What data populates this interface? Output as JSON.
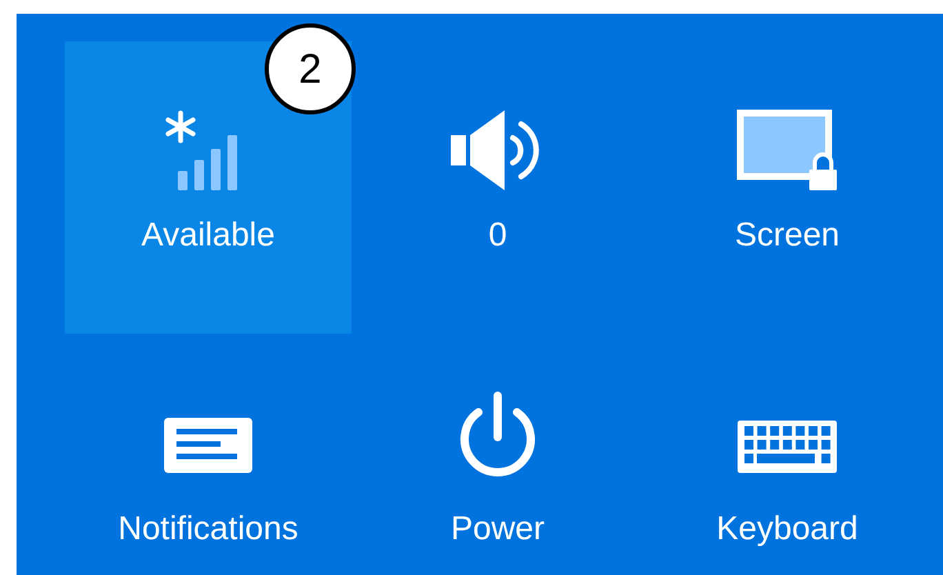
{
  "tiles": [
    {
      "kind": "network",
      "label": "Available",
      "selected": true
    },
    {
      "kind": "volume",
      "label": "0",
      "selected": false
    },
    {
      "kind": "screen",
      "label": "Screen",
      "selected": false
    },
    {
      "kind": "notifications",
      "label": "Notifications",
      "selected": false
    },
    {
      "kind": "power",
      "label": "Power",
      "selected": false
    },
    {
      "kind": "keyboard",
      "label": "Keyboard",
      "selected": false
    }
  ],
  "callout": {
    "text": "2"
  }
}
